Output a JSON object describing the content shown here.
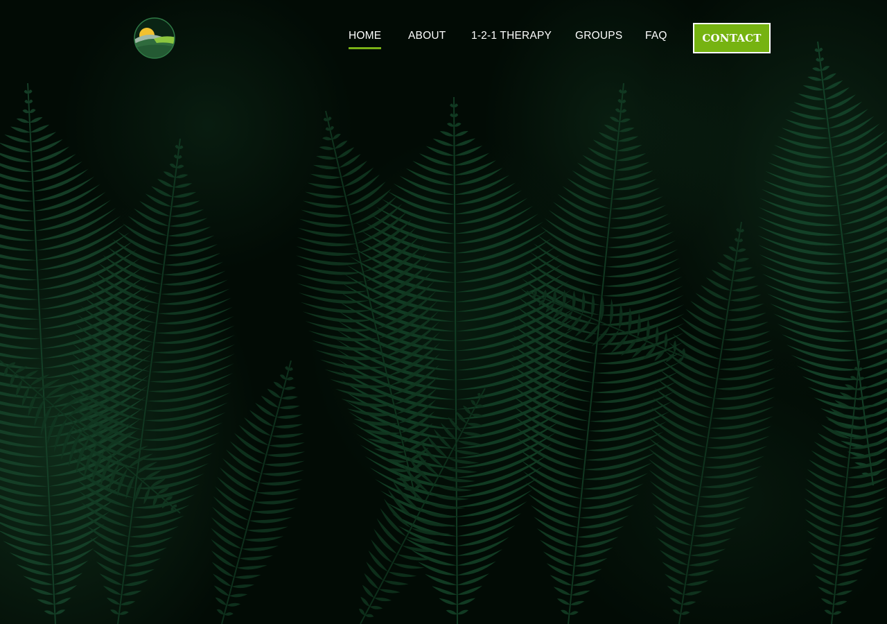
{
  "logo": {
    "icon": "sunrise-hills-logo-icon"
  },
  "nav": {
    "items": [
      {
        "label": "HOME",
        "active": true
      },
      {
        "label": "ABOUT",
        "active": false
      },
      {
        "label": "1-2-1 THERAPY",
        "active": false
      },
      {
        "label": "GROUPS",
        "active": false
      },
      {
        "label": "FAQ",
        "active": false
      }
    ],
    "contact_label": "CONTACT"
  },
  "colors": {
    "accent": "#76b311",
    "background": "#020b05",
    "foliage": "#1a4a2a"
  }
}
